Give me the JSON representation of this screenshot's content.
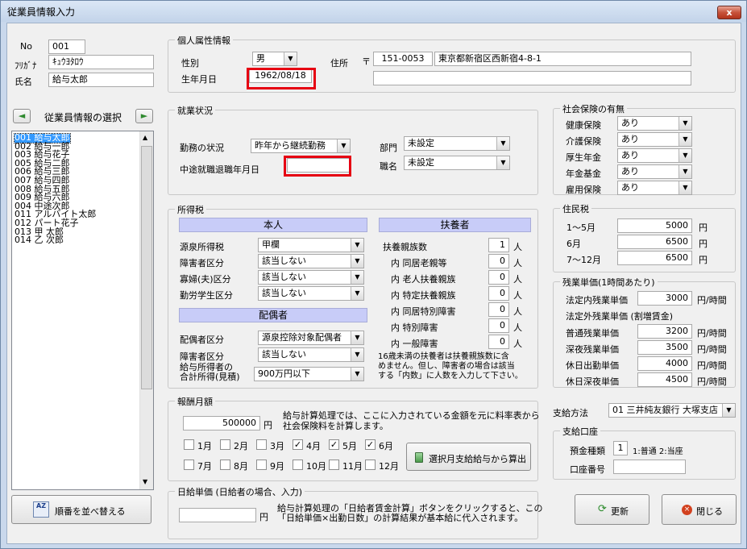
{
  "window": {
    "title": "従業員情報入力",
    "close_label": "x"
  },
  "employee": {
    "no_label": "No",
    "no_value": "001",
    "kana_label": "ﾌﾘｶﾞﾅ",
    "kana_value": "ｷｭｳﾖﾀﾛｳ",
    "name_label": "氏名",
    "name_value": "給与太郎"
  },
  "selector": {
    "title": "従業員情報の選択",
    "prev": "◄",
    "next": "►"
  },
  "employee_list": [
    "001 給与太郎",
    "002 給与一郎",
    "003 給与花子",
    "005 給与二郎",
    "006 給与三郎",
    "007 給与四郎",
    "008 給与五郎",
    "009 給与六郎",
    "004 中途次郎",
    "011 アルバイト太郎",
    "012 パート花子",
    "013 甲  太郎",
    "014 乙  次郎"
  ],
  "sort_button": {
    "label": "順番を並べ替える",
    "icon": "AZ"
  },
  "personal": {
    "title": "個人属性情報",
    "gender_label": "性別",
    "gender_value": "男",
    "birth_label": "生年月日",
    "birth_value": "1962/08/18",
    "address_label": "住所",
    "postal_mark": "〒",
    "postal_value": "151-0053",
    "address_value": "東京都新宿区西新宿4-8-1",
    "address2_value": ""
  },
  "employment": {
    "title": "就業状況",
    "status_label": "勤務の状況",
    "status_value": "昨年から継続勤務",
    "midjoin_label": "中途就職退職年月日",
    "midjoin_value": "",
    "dept_label": "部門",
    "dept_value": "未設定",
    "job_label": "職名",
    "job_value": "未設定"
  },
  "social_insurance": {
    "title": "社会保険の有無",
    "items": [
      {
        "label": "健康保険",
        "value": "あり"
      },
      {
        "label": "介護保険",
        "value": "あり"
      },
      {
        "label": "厚生年金",
        "value": "あり"
      },
      {
        "label": "年金基金",
        "value": "あり"
      },
      {
        "label": "雇用保険",
        "value": "あり"
      }
    ]
  },
  "income_tax": {
    "title": "所得税",
    "self_header": "本人",
    "self_rows": [
      {
        "label": "源泉所得税",
        "value": "甲欄"
      },
      {
        "label": "障害者区分",
        "value": "該当しない"
      },
      {
        "label": "寡婦(夫)区分",
        "value": "該当しない"
      },
      {
        "label": "勤労学生区分",
        "value": "該当しない"
      }
    ],
    "spouse_header": "配偶者",
    "spouse_rows": [
      {
        "label": "配偶者区分",
        "value": "源泉控除対象配偶者"
      },
      {
        "label": "障害者区分",
        "value": "該当しない"
      }
    ],
    "spouse_income_label1": "給与所得者の",
    "spouse_income_label2": "合計所得(見積)",
    "spouse_income_value": "900万円以下",
    "dependents_header": "扶養者",
    "dependents_rows": [
      {
        "label": "扶養親族数",
        "value": "1",
        "unit": "人"
      },
      {
        "label": "内 同居老親等",
        "value": "0",
        "unit": "人"
      },
      {
        "label": "内 老人扶養親族",
        "value": "0",
        "unit": "人"
      },
      {
        "label": "内 特定扶養親族",
        "value": "0",
        "unit": "人"
      },
      {
        "label": "内 同居特別障害",
        "value": "0",
        "unit": "人"
      },
      {
        "label": "内 特別障害",
        "value": "0",
        "unit": "人"
      },
      {
        "label": "内 一般障害",
        "value": "0",
        "unit": "人"
      }
    ],
    "note1": "16歳未満の扶養者は扶養親族数に含",
    "note2": "めません。但し、障害者の場合は該当",
    "note3": "する「内数」に人数を入力して下さい。"
  },
  "resident_tax": {
    "title": "住民税",
    "rows": [
      {
        "label": "1～5月",
        "value": "5000",
        "unit": "円"
      },
      {
        "label": "6月",
        "value": "6500",
        "unit": "円"
      },
      {
        "label": "7～12月",
        "value": "6500",
        "unit": "円"
      }
    ]
  },
  "overtime": {
    "title": "残業単価(1時間あたり)",
    "statutory_label": "法定内残業単価",
    "statutory_value": "3000",
    "statutory_unit": "円/時間",
    "extra_header": "法定外残業単価 (割増賃金)",
    "rows": [
      {
        "label": "普通残業単価",
        "value": "3200",
        "unit": "円/時間"
      },
      {
        "label": "深夜残業単価",
        "value": "3500",
        "unit": "円/時間"
      },
      {
        "label": "休日出勤単価",
        "value": "4000",
        "unit": "円/時間"
      },
      {
        "label": "休日深夜単価",
        "value": "4500",
        "unit": "円/時間"
      }
    ]
  },
  "monthly_pay": {
    "title": "報酬月額",
    "value": "500000",
    "unit": "円",
    "note1": "給与計算処理では、ここに入力されている金額を元に料率表から",
    "note2": "社会保険料を計算します。",
    "months": [
      {
        "label": "1月",
        "checked": false
      },
      {
        "label": "2月",
        "checked": false
      },
      {
        "label": "3月",
        "checked": false
      },
      {
        "label": "4月",
        "checked": true
      },
      {
        "label": "5月",
        "checked": true
      },
      {
        "label": "6月",
        "checked": true
      },
      {
        "label": "7月",
        "checked": false
      },
      {
        "label": "8月",
        "checked": false
      },
      {
        "label": "9月",
        "checked": false
      },
      {
        "label": "10月",
        "checked": false
      },
      {
        "label": "11月",
        "checked": false
      },
      {
        "label": "12月",
        "checked": false
      }
    ],
    "calc_button": "選択月支給給与から算出"
  },
  "daily_pay": {
    "title": "日給単価 (日給者の場合、入力)",
    "value": "",
    "unit": "円",
    "note1": "給与計算処理の「日給者賃金計算」ボタンをクリックすると、この",
    "note2": "「日給単価×出勤日数」の計算結果が基本給に代入されます。"
  },
  "payment": {
    "method_label": "支給方法",
    "method_value": "01 三井純友銀行 大塚支店",
    "account_title": "支給口座",
    "deposit_label": "預金種類",
    "deposit_value": "1",
    "deposit_hint": "1:普通  2:当座",
    "account_label": "口座番号",
    "account_value": ""
  },
  "buttons": {
    "update": "更新",
    "close": "閉じる"
  }
}
